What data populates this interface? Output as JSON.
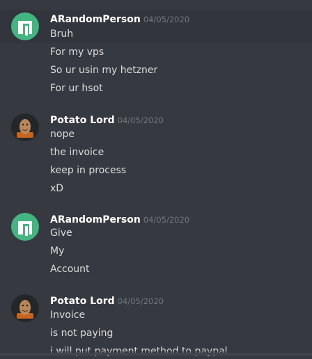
{
  "messages": [
    {
      "author": "ARandomPerson",
      "timestamp": "04/05/2020",
      "avatar": "green-android-icon",
      "lines": [
        "Bruh",
        "For my vps",
        "So ur usin my hetzner",
        "For ur hsot"
      ]
    },
    {
      "author": "Potato Lord",
      "timestamp": "04/05/2020",
      "avatar": "potato-icon",
      "lines": [
        "nope",
        "the invoice",
        "keep in process",
        "xD"
      ]
    },
    {
      "author": "ARandomPerson",
      "timestamp": "04/05/2020",
      "avatar": "green-android-icon",
      "lines": [
        "Give",
        "My",
        "Account"
      ]
    },
    {
      "author": "Potato Lord",
      "timestamp": "04/05/2020",
      "avatar": "potato-icon",
      "lines": [
        "Invoice",
        "is not paying",
        "i will put payment method to paypal"
      ]
    }
  ],
  "colors": {
    "background": "#36393f",
    "hover": "#32353b",
    "username": "#ffffff",
    "timestamp": "#72767d",
    "text": "#dcddde",
    "avatar_green": "#43b581"
  }
}
